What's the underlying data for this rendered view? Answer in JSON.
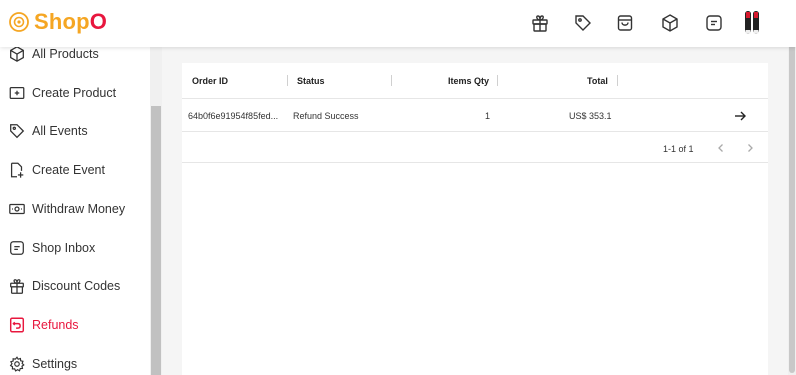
{
  "brand": {
    "logo_prefix": "Shop",
    "logo_suffix": "O",
    "colors": {
      "accent": "#f5a623",
      "brand_red": "#e8173e"
    }
  },
  "header": {
    "icons": [
      "gift-icon",
      "tag-icon",
      "shopping-bag-icon",
      "package-icon",
      "message-icon",
      "user-avatar"
    ]
  },
  "sidebar": {
    "items": [
      {
        "label": "All Products",
        "icon": "package-icon"
      },
      {
        "label": "Create Product",
        "icon": "folder-plus-icon"
      },
      {
        "label": "All Events",
        "icon": "tag-icon"
      },
      {
        "label": "Create Event",
        "icon": "file-plus-icon"
      },
      {
        "label": "Withdraw Money",
        "icon": "cash-icon"
      },
      {
        "label": "Shop Inbox",
        "icon": "message-icon"
      },
      {
        "label": "Discount Codes",
        "icon": "gift-icon"
      },
      {
        "label": "Refunds",
        "icon": "receipt-refund-icon",
        "active": true
      },
      {
        "label": "Settings",
        "icon": "gear-icon"
      }
    ]
  },
  "table": {
    "columns": [
      "Order ID",
      "Status",
      "Items Qty",
      "Total"
    ],
    "rows": [
      {
        "order_id": "64b0f6e91954f85fed...",
        "status": "Refund Success",
        "qty": "1",
        "total": "US$ 353.1"
      }
    ]
  },
  "pagination": {
    "text": "1-1 of 1"
  }
}
